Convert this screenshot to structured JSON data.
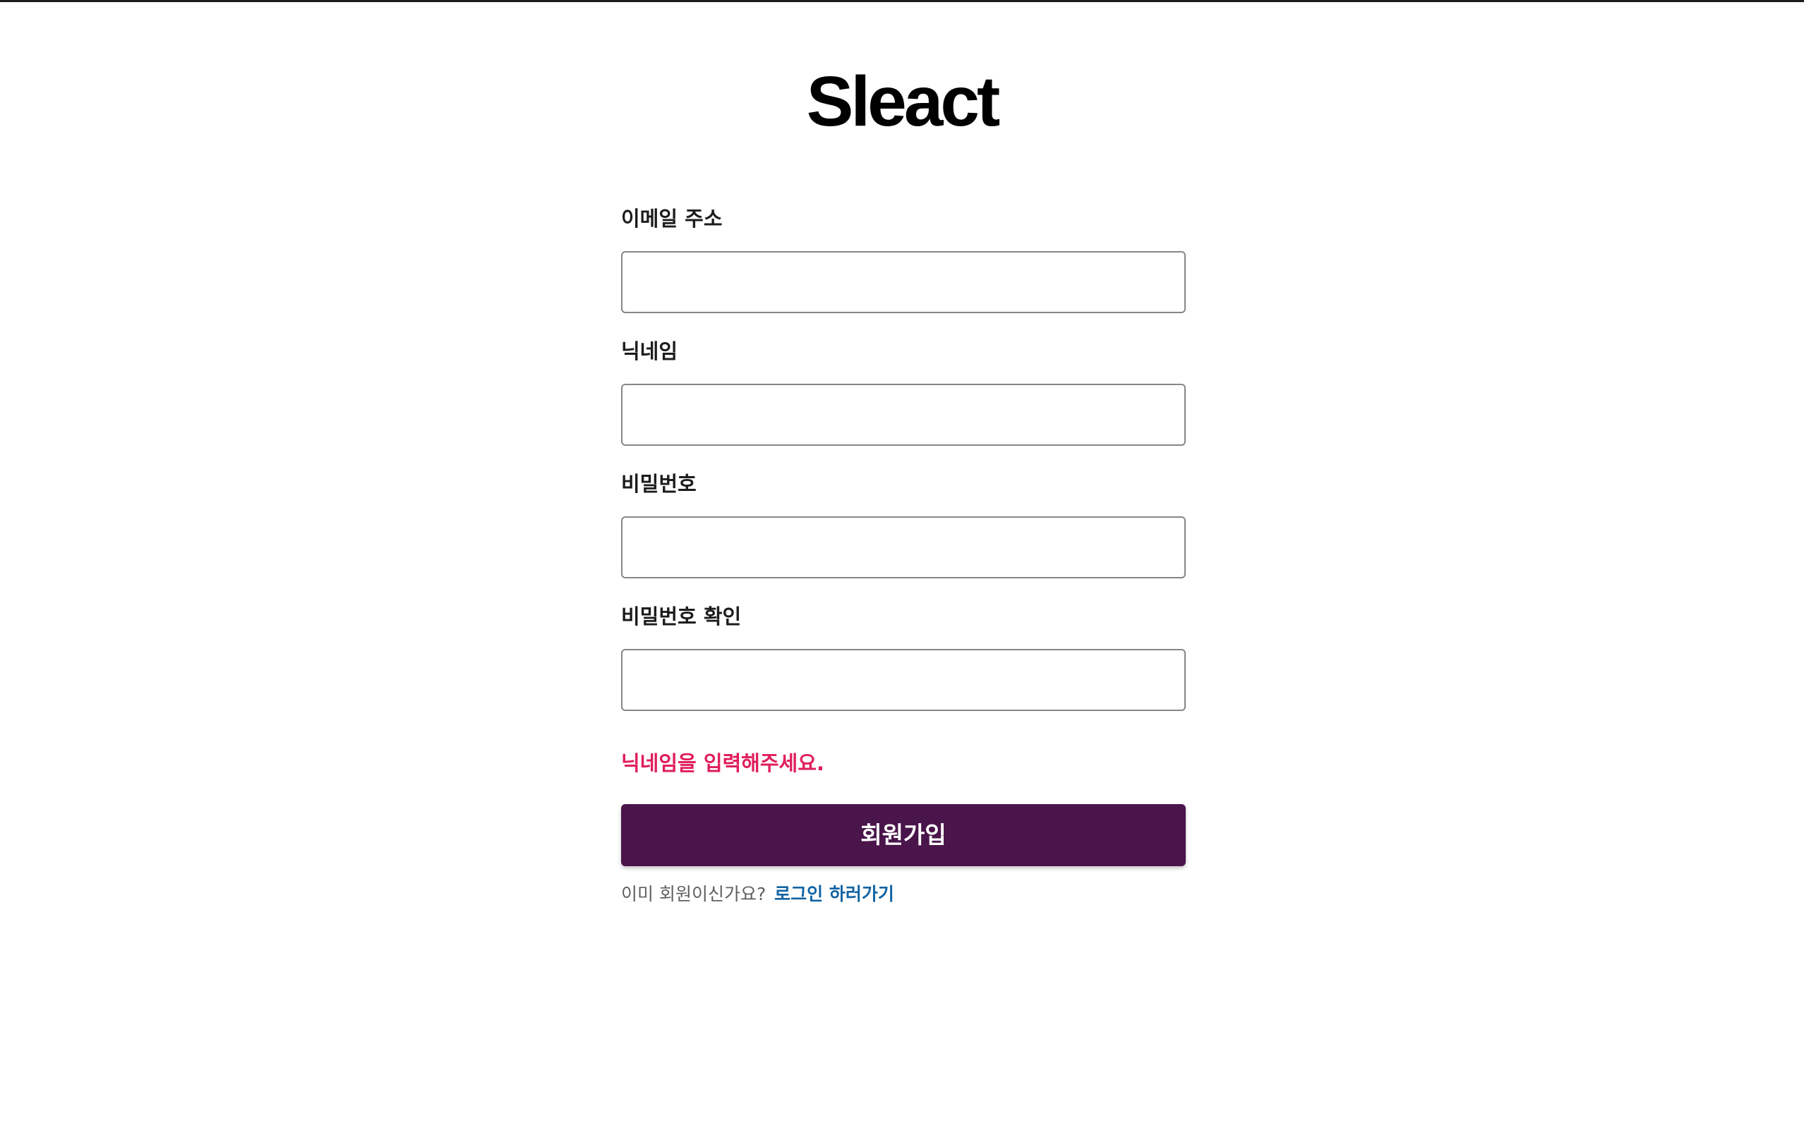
{
  "app": {
    "logo": "Sleact"
  },
  "form": {
    "email_label": "이메일 주소",
    "email_value": "",
    "nickname_label": "닉네임",
    "nickname_value": "",
    "password_label": "비밀번호",
    "password_value": "",
    "password_check_label": "비밀번호 확인",
    "password_check_value": "",
    "error_message": "닉네임을 입력해주세요.",
    "submit_label": "회원가입"
  },
  "footer": {
    "prompt": "이미 회원이신가요?",
    "link_label": "로그인 하러가기"
  },
  "colors": {
    "brand": "#4a154b",
    "error": "#e01e5a",
    "link": "#1264a3"
  }
}
